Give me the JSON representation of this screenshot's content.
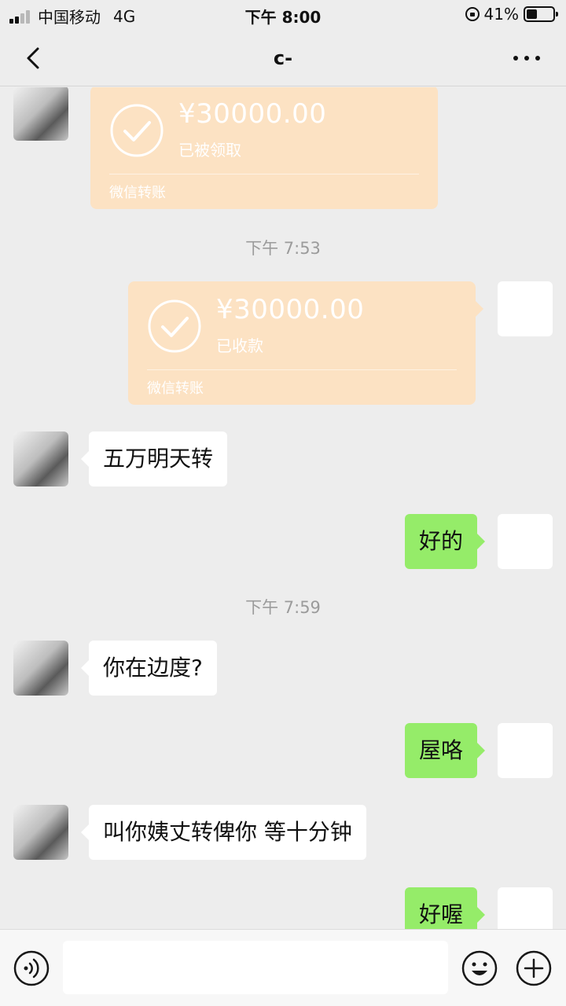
{
  "status_bar": {
    "carrier": "中国移动",
    "network": "4G",
    "time": "下午 8:00",
    "battery_text": "41%",
    "battery_level": 0.41
  },
  "nav": {
    "title": "c-",
    "back_icon": "chevron-left-icon",
    "more_icon": "more-dots-icon"
  },
  "messages": {
    "transfer_received": {
      "amount": "¥30000.00",
      "status": "已被领取",
      "label": "微信转账"
    },
    "time_1": "下午 7:53",
    "transfer_sent": {
      "amount": "¥30000.00",
      "status": "已收款",
      "label": "微信转账"
    },
    "msg_1": "五万明天转",
    "msg_2": "好的",
    "time_2": "下午 7:59",
    "msg_3": "你在边度?",
    "msg_4": "屋咯",
    "msg_5": "叫你姨丈转俾你 等十分钟",
    "msg_6": "好喔"
  },
  "input_bar": {
    "voice_icon": "voice-icon",
    "emoji_icon": "emoji-icon",
    "plus_icon": "plus-icon",
    "text_value": ""
  },
  "colors": {
    "background": "#ededed",
    "self_bubble": "#95ec69",
    "other_bubble": "#ffffff",
    "transfer_card": "#fce2c3"
  }
}
